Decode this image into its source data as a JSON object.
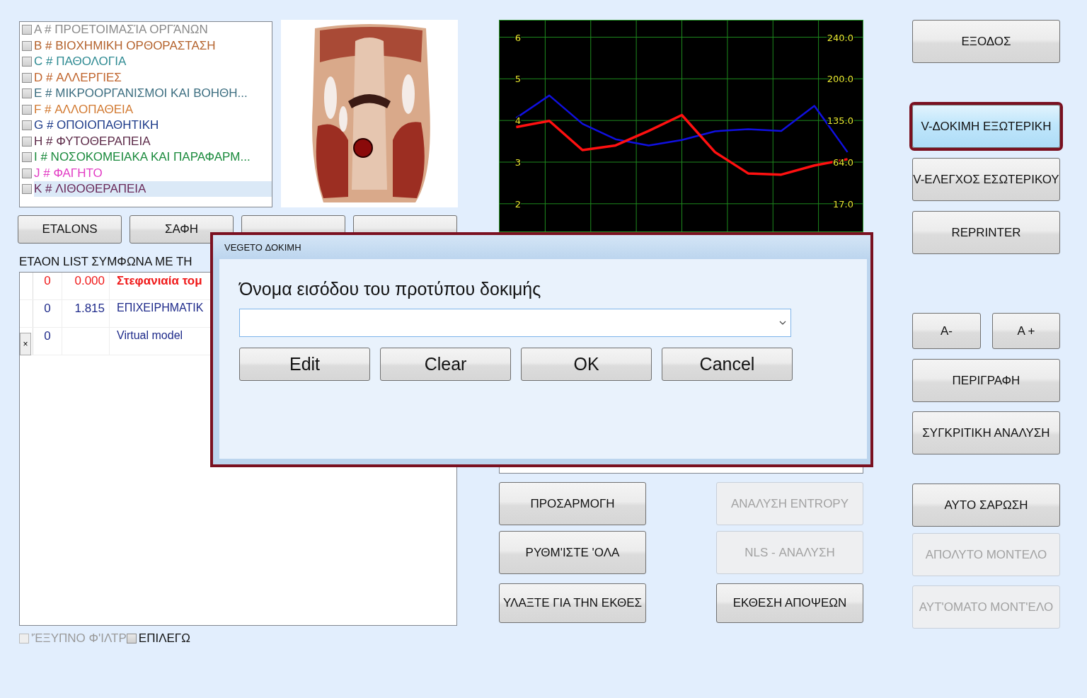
{
  "categories": [
    {
      "label": "A # ΠΡΟΕΤΟΙΜΑΣΊΑ ΟΡΓΆΝΩΝ",
      "color": "#8a8a8a",
      "checked": false,
      "selected": false
    },
    {
      "label": "B # ΒΙΟΧΗΜΙΚΗ ΟΡΘΟΡΑΣΤΑΣΗ",
      "color": "#b4622c",
      "checked": false,
      "selected": false
    },
    {
      "label": "C # ΠΑΘΟΛΟΓΙΑ",
      "color": "#2e8a92",
      "checked": false,
      "selected": false
    },
    {
      "label": "D # ΑΛΛΕΡΓΙΕΣ",
      "color": "#c0642c",
      "checked": false,
      "selected": false
    },
    {
      "label": "E # ΜΙΚΡΟΟΡΓΑΝΙΣΜΟΙ ΚΑΙ ΒΟΗΘΗ...",
      "color": "#3c6e80",
      "checked": false,
      "selected": false
    },
    {
      "label": "F # ΑΛΛΟΠΑΘΕΙΑ",
      "color": "#d27a32",
      "checked": false,
      "selected": false
    },
    {
      "label": "G # ΟΠΟΙΟΠΑΘΗΤΙΚΗ",
      "color": "#1e3c8a",
      "checked": false,
      "selected": false
    },
    {
      "label": "H # ΦΥΤΟΘΕΡΑΠΕΙΑ",
      "color": "#5c2a48",
      "checked": false,
      "selected": false
    },
    {
      "label": "I # ΝΟΣΟΚΟΜΕΙΑΚΑ ΚΑΙ ΠΑΡΑΦΑΡΜ...",
      "color": "#1a8a3c",
      "checked": false,
      "selected": false
    },
    {
      "label": "J # ΦΑΓΗΤΟ",
      "color": "#e23cc4",
      "checked": false,
      "selected": false
    },
    {
      "label": "K # ΛΙΘΟΘΕΡΑΠΕΙΑ",
      "color": "#6a2a5a",
      "checked": false,
      "selected": true
    }
  ],
  "left_buttons": [
    {
      "label": "ETALONS",
      "disabled": false
    },
    {
      "label": "ΣΑΦΗ",
      "disabled": false
    },
    {
      "disabled": false
    },
    {
      "disabled": false
    }
  ],
  "list_title": "ETAON LIST ΣΥΜΦΩΝΑ ΜΕ ΤΗ",
  "table": {
    "rows": [
      {
        "column_1": "0",
        "column_2": "0.000",
        "column_3": "Στεφανιαία τομ",
        "emphasis": true
      },
      {
        "column_1": "0",
        "column_2": "1.815",
        "column_3": "ΕΠΙΧΕΙΡΗΜΑΤΙΚ",
        "emphasis": false
      },
      {
        "row_button": "×",
        "column_1": "0",
        "column_3": "Virtual model",
        "emphasis": false
      }
    ]
  },
  "checkboxes": [
    {
      "label": "'ΈΞΥΠΝΟ Φ'ΙΛΤΡ",
      "checked": false,
      "disabled": true
    },
    {
      "label": "ΕΠΙΛΕΓΩ",
      "checked": false,
      "disabled": false
    }
  ],
  "chart": {
    "right_ticks": [
      "240.0",
      "200.0",
      "135.0",
      "64.0",
      "17.0"
    ],
    "chart_data": {
      "type": "line",
      "categories": [
        null,
        null,
        null,
        null,
        null,
        null,
        null,
        null,
        null,
        null,
        null
      ],
      "ylim": [
        1.3,
        6.4
      ],
      "yticks": [
        6,
        5,
        4,
        3,
        2
      ],
      "grid": true,
      "series": [
        {
          "color": "#1010e0",
          "values": [
            4.06,
            4.6,
            3.92,
            3.55,
            3.4,
            3.53,
            3.74,
            3.79,
            3.75,
            4.35,
            3.24
          ]
        },
        {
          "color": "#ff1010",
          "values": [
            3.84,
            3.99,
            3.29,
            3.4,
            3.75,
            4.13,
            3.24,
            2.73,
            2.7,
            2.92,
            3.07
          ]
        }
      ]
    }
  },
  "middle_buttons": [
    {
      "label": "ΠΡΟΣΑΡΜΟΓΗ",
      "disabled": false
    },
    {
      "label": "ΑΝΑΛΥΣΗ ENTROPY",
      "disabled": true
    },
    {
      "label": "ΡΥΘΜ'ΙΣΤΕ 'ΟΛΑ",
      "disabled": false
    },
    {
      "label": "NLS - ΑΝΑΛΥΣΗ",
      "disabled": true
    },
    {
      "label": "ΥΛΑΞΤΕ ΓΙΑ ΤΗΝ ΕΚΘΕΣ",
      "disabled": false
    },
    {
      "label": "ΕΚΘΕΣΗ ΑΠΟΨΕΩΝ",
      "disabled": false
    }
  ],
  "right_buttons": [
    {
      "label": "ΕΞΟΔΟΣ",
      "disabled": false,
      "focused": false
    },
    {
      "label": "V-ΔΟΚΙΜΗ ΕΞΩΤΕΡΙΚΗ",
      "disabled": false,
      "focused": true
    },
    {
      "label": "V-ΕΛΕΓΧΟΣ ΕΣΩΤΕΡΙΚΟΥ",
      "disabled": false,
      "focused": false
    },
    {
      "label": "REPRINTER",
      "disabled": false,
      "focused": false
    },
    {
      "label": "A-",
      "disabled": false,
      "focused": false
    },
    {
      "label": "A +",
      "disabled": false,
      "focused": false
    },
    {
      "label": "ΠΕΡΙΓΡΑΦΗ",
      "disabled": false,
      "focused": false
    },
    {
      "label": "ΣΥΓΚΡΙΤΙΚΗ ΑΝΑΛΥΣΗ",
      "disabled": false,
      "focused": false
    },
    {
      "label": "ΑΥΤΟ ΣΑΡΩΣΗ",
      "disabled": false,
      "focused": false
    },
    {
      "label": "ΑΠΟΛΥΤΟ ΜΟΝΤΕΛΟ",
      "disabled": true,
      "focused": false
    },
    {
      "label": "ΑΥΤ'ΟΜΑΤΟ ΜΟΝΤ'ΕΛΟ",
      "disabled": true,
      "focused": false
    }
  ],
  "dialog": {
    "title": "VEGETO ΔΟΚΙΜΗ",
    "prompt": "Όνομα εισόδου του προτύπου δοκιμής",
    "buttons": [
      "Edit",
      "Clear",
      "OK",
      "Cancel"
    ]
  }
}
